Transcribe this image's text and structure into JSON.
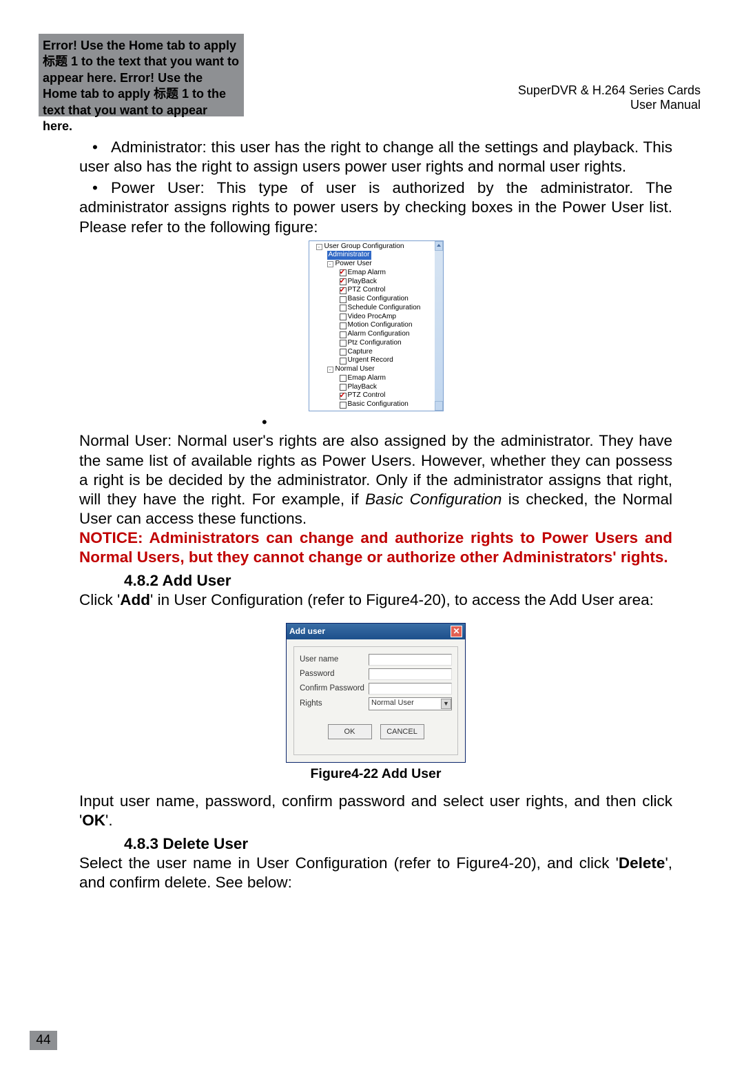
{
  "header": {
    "error_text": "Error! Use the Home tab to apply 标题 1 to the text that you want to appear here. Error! Use the Home tab to apply 标题 1 to the text that you want to appear here.",
    "product": "SuperDVR & H.264 Series Cards",
    "subtitle": "User Manual"
  },
  "body": {
    "p1_lead": "Administrator: this user has the right to change all the settings and playback. This user also has the right to assign users power user rights and normal user rights.",
    "p2_lead": "Power User: This type of user is authorized by the administrator. The administrator assigns rights to power users by checking boxes in the Power User list. Please refer to the following figure:",
    "p3_run1": "Normal User: Normal user's rights are also assigned by the administrator. They have the same list of available rights as Power Users. However, whether they can possess a right is be decided by the administrator. Only if the administrator assigns that right, will they have the right. For example, if ",
    "p3_em": "Basic Configuration",
    "p3_run2": " is checked, the Normal User can access these functions.",
    "notice": "NOTICE: Administrators can change and authorize rights to Power Users and Normal Users, but they cannot change or authorize other Administrators' rights.",
    "s482": "4.8.2  Add User",
    "s482_run1": "Click '",
    "s482_add": "Add",
    "s482_run2": "' in User Configuration (refer to Figure4-20), to access the Add User area:",
    "figcap": "Figure4-22 Add User",
    "p4_run1": "Input user name, password, confirm password and select user rights, and then click '",
    "p4_ok": "OK",
    "p4_run2": "'.",
    "s483": "4.8.3  Delete User",
    "s483_run1": "Select the user name in User Configuration (refer to Figure4-20), and click '",
    "s483_del": "Delete",
    "s483_run2": "', and confirm delete. See below:"
  },
  "tree": {
    "root": "User Group Configuration",
    "admin": "Administrator",
    "pu": "Power User",
    "nu": "Normal User",
    "items": {
      "emap": "Emap Alarm",
      "pb": "PlayBack",
      "ptz": "PTZ Control",
      "bc": "Basic Configuration",
      "sc": "Schedule Configuration",
      "vp": "Video ProcAmp",
      "mc": "Motion Configuration",
      "ac": "Alarm Configuration",
      "pc": "Ptz Configuration",
      "cap": "Capture",
      "ur": "Urgent Record"
    }
  },
  "dialog": {
    "title": "Add user",
    "labels": {
      "un": "User name",
      "pw": "Password",
      "cpw": "Confirm Password",
      "rights": "Rights"
    },
    "rights_value": "Normal User",
    "ok": "OK",
    "cancel": "CANCEL"
  },
  "pagenum": "44"
}
